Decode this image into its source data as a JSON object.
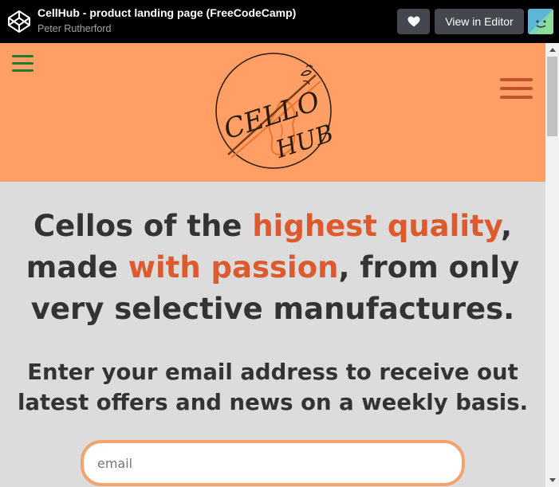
{
  "topbar": {
    "title": "CellHub - product landing page (FreeCodeCamp)",
    "author": "Peter Rutherford",
    "editor_button": "View in Editor",
    "icons": [
      "codepen-logo-icon",
      "heart-icon",
      "avatar"
    ]
  },
  "header": {
    "logo_text_top": "CELLO",
    "logo_text_bottom": "HUB",
    "colors": {
      "background": "#ff9f66",
      "left_menu": "#1f7a34",
      "right_menu": "#c4532c"
    }
  },
  "hero": {
    "part1": "Cellos of the ",
    "highlight1": "highest quality",
    "part2": ", made ",
    "highlight2": "with passion",
    "part3": ", from only very selective manufactures.",
    "highlight_color": "#dc5a2d"
  },
  "subtitle": "Enter your email address to receive out latest offers and news on a weekly basis.",
  "email": {
    "placeholder": "email",
    "value": ""
  }
}
